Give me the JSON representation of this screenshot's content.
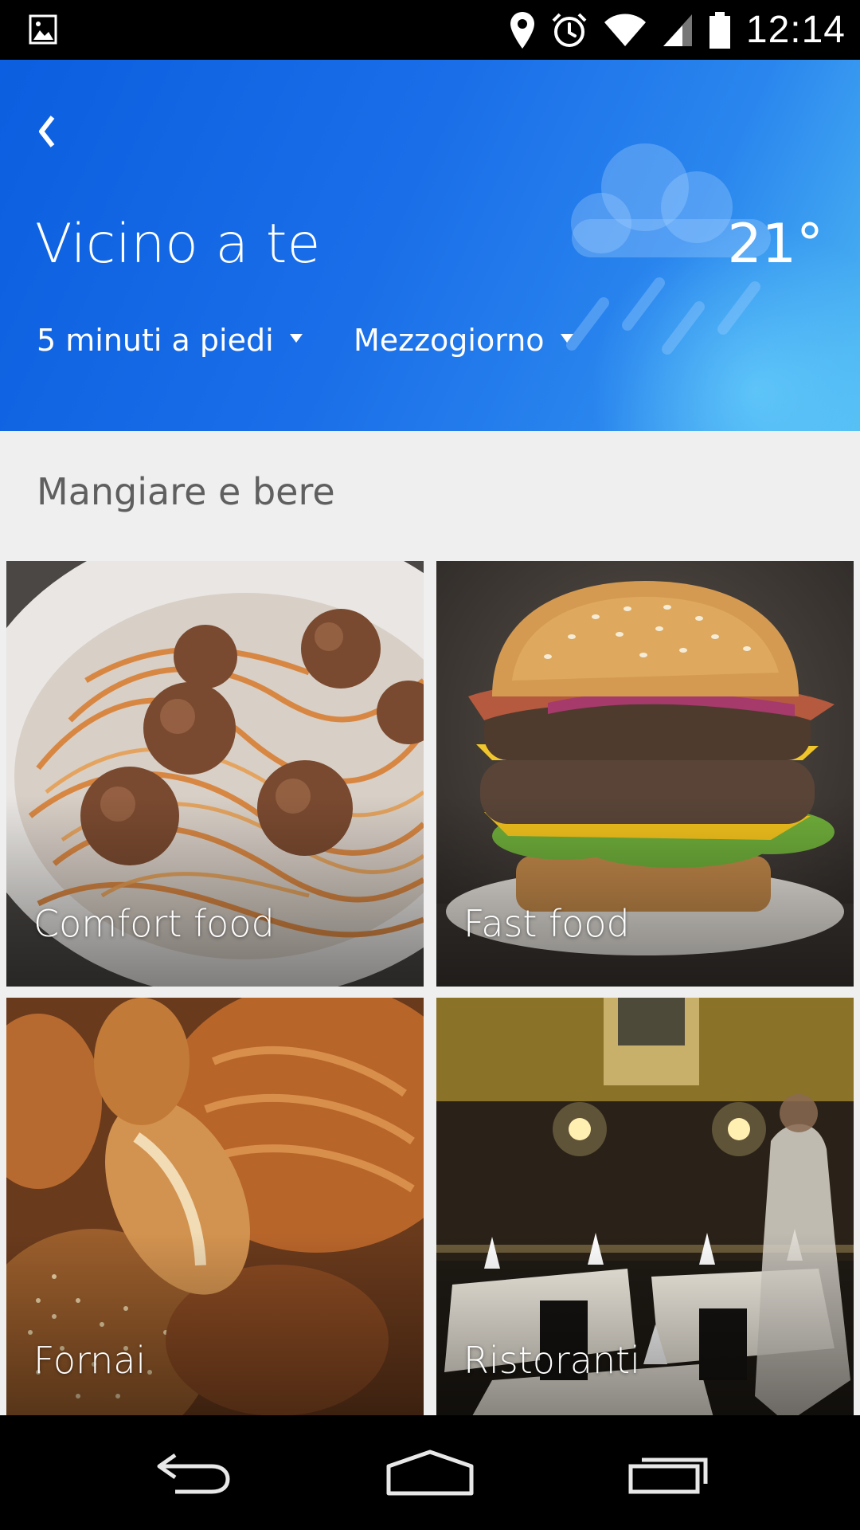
{
  "status_bar": {
    "time": "12:14",
    "icons": [
      "image-notification-icon",
      "location-icon",
      "alarm-icon",
      "wifi-icon",
      "cell-signal-icon",
      "battery-icon"
    ]
  },
  "header": {
    "back_icon": "chevron-left-icon",
    "title": "Vicino a te",
    "temperature": "21°",
    "weather_icon": "rain-cloud-icon",
    "walk_dropdown": "5 minuti a piedi",
    "time_dropdown": "Mezzogiorno",
    "colors": {
      "gradient_start": "#0b5fe0",
      "gradient_end": "#4fb9f3"
    }
  },
  "section": {
    "title": "Mangiare e bere"
  },
  "tiles": [
    {
      "label": "Comfort food"
    },
    {
      "label": "Fast food"
    },
    {
      "label": "Fornai"
    },
    {
      "label": "Ristoranti"
    }
  ],
  "nav_bar": {
    "icons": [
      "back-nav-icon",
      "home-nav-icon",
      "recents-nav-icon"
    ]
  }
}
